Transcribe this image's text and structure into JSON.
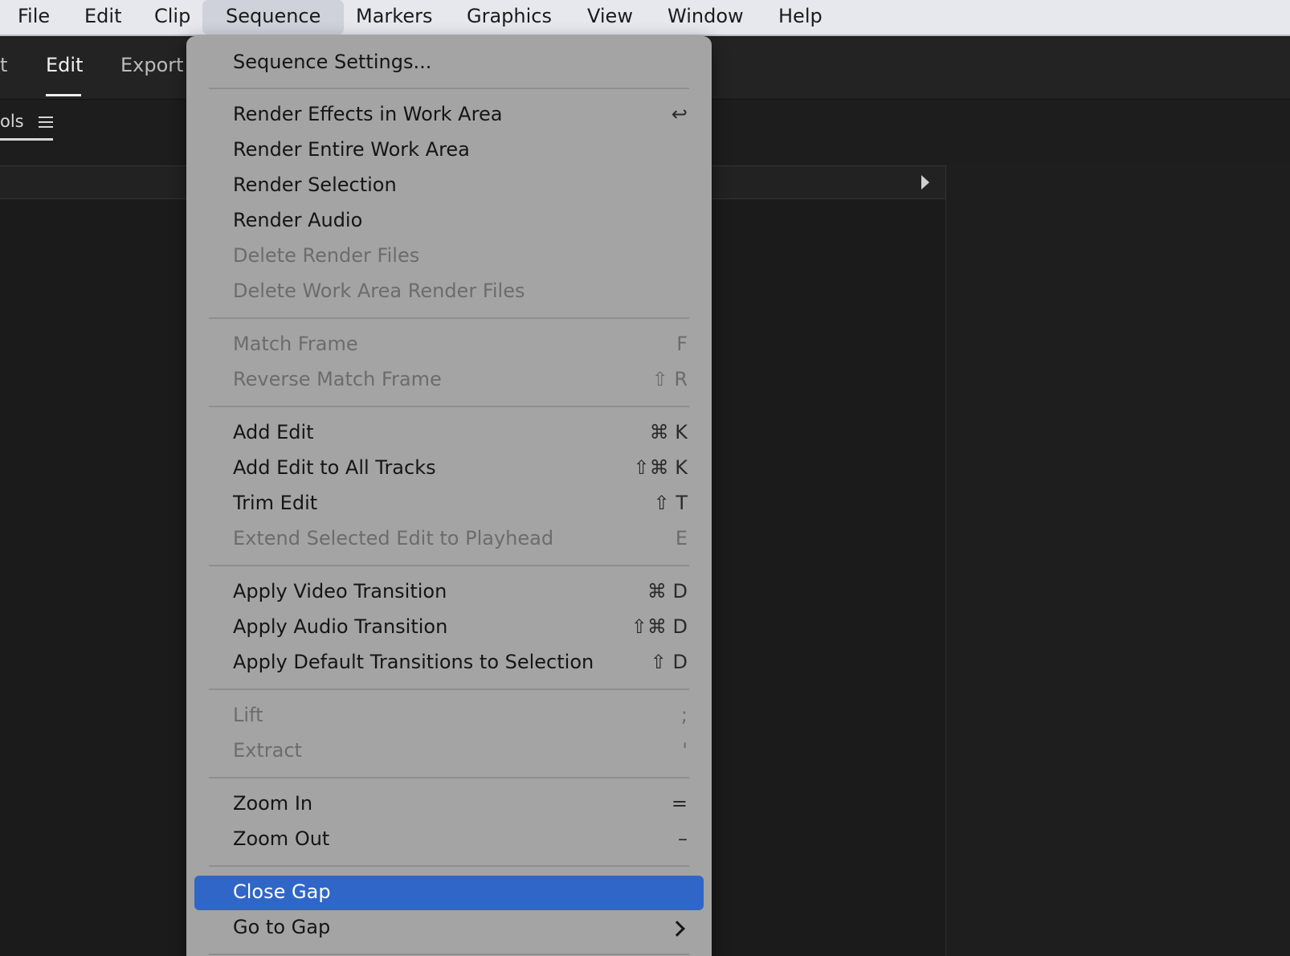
{
  "menubar": {
    "items": [
      "File",
      "Edit",
      "Clip",
      "Sequence",
      "Markers",
      "Graphics",
      "View",
      "Window",
      "Help"
    ],
    "active": "Sequence"
  },
  "workspace_tabs": {
    "partial": "t",
    "edit": "Edit",
    "export": "Export"
  },
  "panel": {
    "tab_label": "ols"
  },
  "sequence_menu": {
    "items": [
      {
        "label": "Sequence Settings...",
        "shortcut": "",
        "disabled": false
      },
      {
        "label": "Render Effects in Work Area",
        "shortcut": "↩",
        "disabled": false
      },
      {
        "label": "Render Entire Work Area",
        "shortcut": "",
        "disabled": false
      },
      {
        "label": "Render Selection",
        "shortcut": "",
        "disabled": false
      },
      {
        "label": "Render Audio",
        "shortcut": "",
        "disabled": false
      },
      {
        "label": "Delete Render Files",
        "shortcut": "",
        "disabled": true
      },
      {
        "label": "Delete Work Area Render Files",
        "shortcut": "",
        "disabled": true
      },
      {
        "label": "Match Frame",
        "shortcut": "F",
        "disabled": true
      },
      {
        "label": "Reverse Match Frame",
        "shortcut": "⇧ R",
        "disabled": true
      },
      {
        "label": "Add Edit",
        "shortcut": "⌘ K",
        "disabled": false
      },
      {
        "label": "Add Edit to All Tracks",
        "shortcut": "⇧⌘ K",
        "disabled": false
      },
      {
        "label": "Trim Edit",
        "shortcut": "⇧ T",
        "disabled": false
      },
      {
        "label": "Extend Selected Edit to Playhead",
        "shortcut": "E",
        "disabled": true
      },
      {
        "label": "Apply Video Transition",
        "shortcut": "⌘ D",
        "disabled": false
      },
      {
        "label": "Apply Audio Transition",
        "shortcut": "⇧⌘ D",
        "disabled": false
      },
      {
        "label": "Apply Default Transitions to Selection",
        "shortcut": "⇧ D",
        "disabled": false
      },
      {
        "label": "Lift",
        "shortcut": ";",
        "disabled": true
      },
      {
        "label": "Extract",
        "shortcut": "'",
        "disabled": true
      },
      {
        "label": "Zoom In",
        "shortcut": "=",
        "disabled": false
      },
      {
        "label": "Zoom Out",
        "shortcut": "–",
        "disabled": false
      },
      {
        "label": "Close Gap",
        "shortcut": "",
        "disabled": false,
        "highlighted": true
      },
      {
        "label": "Go to Gap",
        "shortcut": "",
        "disabled": false,
        "submenu": true
      }
    ]
  },
  "colors": {
    "menu_highlight": "#2f66c8",
    "menu_background": "#a4a4a4",
    "menubar_background": "#e6e8ee",
    "app_background": "#1e1e1e"
  },
  "icons": {
    "panel_menu": "hamburger-menu-icon",
    "panel_expand": "triangle-right-icon",
    "submenu": "chevron-right-icon",
    "return": "return-key-icon"
  }
}
